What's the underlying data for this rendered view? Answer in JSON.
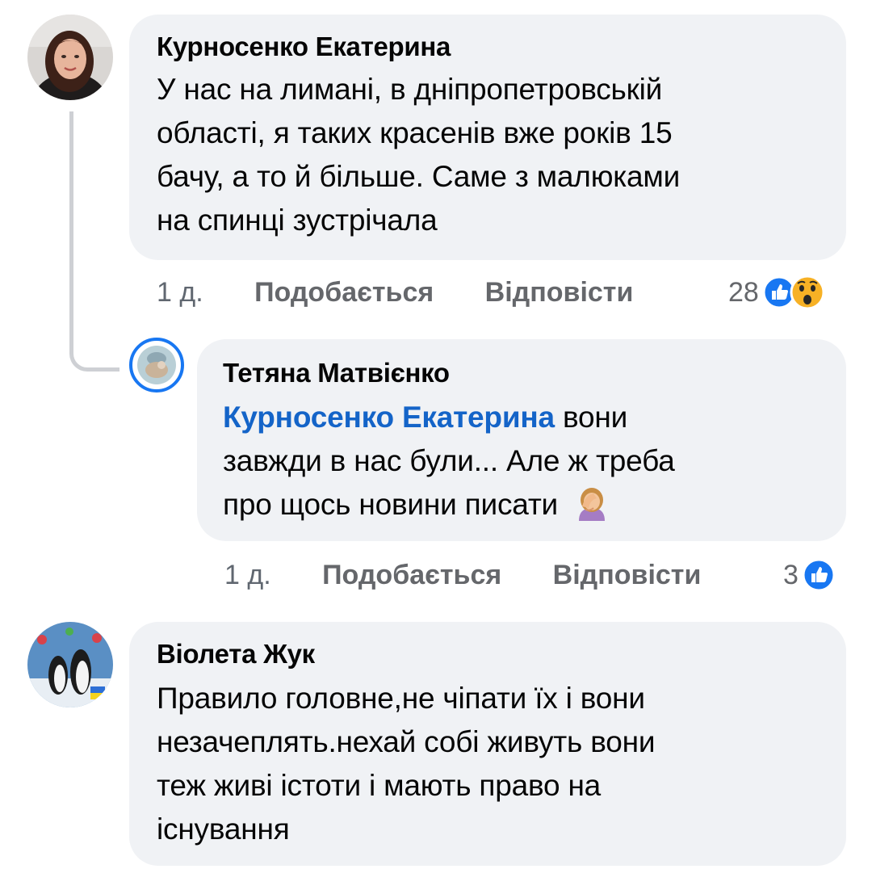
{
  "comments": [
    {
      "author": "Курносенко Екатерина",
      "lines": [
        "У нас на лимані, в дніпропетровській",
        "області, я таких красенів вже років 15",
        "бачу, а то й більше. Саме з малюками",
        "на спинці зустрічала"
      ],
      "time": "1 д.",
      "like_label": "Подобається",
      "reply_label": "Відповісти",
      "reaction_count": "28",
      "reactions": [
        "like-icon",
        "wow-icon"
      ]
    },
    {
      "author": "Тетяна Матвієнко",
      "mention": "Курносенко Екатерина",
      "line1_rest": " вони",
      "lines": [
        "завжди в нас були... Але ж треба",
        "про щось новини писати"
      ],
      "emoji": "facepalm-emoji",
      "time": "1 д.",
      "like_label": "Подобається",
      "reply_label": "Відповісти",
      "reaction_count": "3",
      "reactions": [
        "like-icon"
      ]
    },
    {
      "author": "Віолета Жук",
      "lines": [
        "Правило головне,не чіпати їх і вони",
        "незачеплять.нехай собі живуть вони",
        "теж живі істоти і мають право на",
        "існування"
      ]
    }
  ],
  "colors": {
    "bubble": "#f0f2f5",
    "mention": "#1464c8",
    "like_blue": "#1877f2",
    "wow_yellow": "#f7b125",
    "muted": "#65676b"
  }
}
